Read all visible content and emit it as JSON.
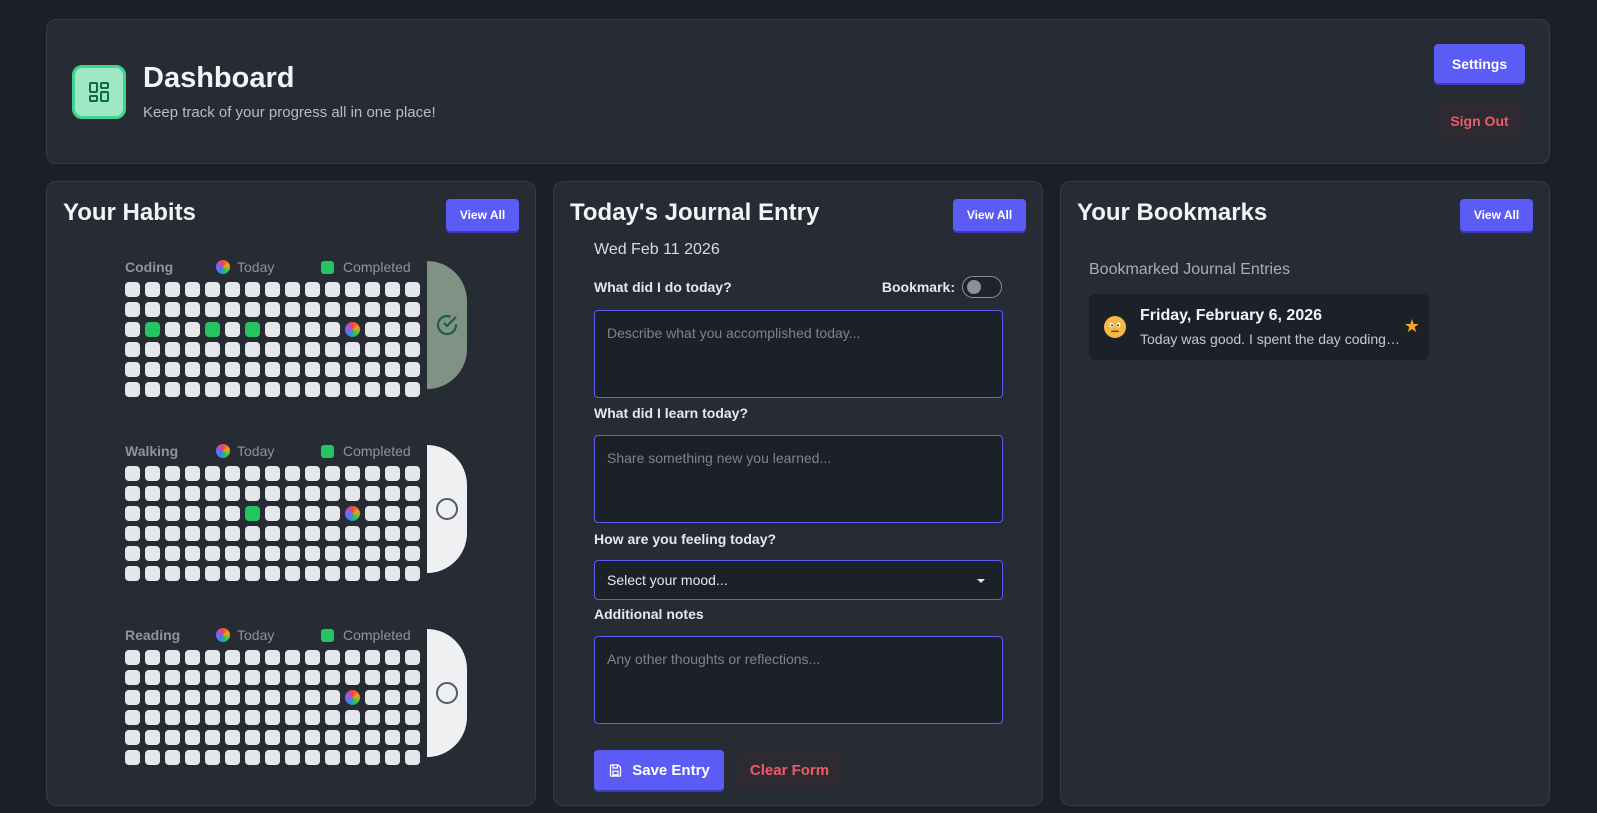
{
  "header": {
    "title": "Dashboard",
    "subtitle": "Keep track of your progress all in one place!",
    "settings_label": "Settings",
    "signout_label": "Sign Out",
    "logo_icon": "dashboard-grid-icon",
    "accent_color": "#5b5bf5",
    "logo_color": "#3fd38e"
  },
  "habits": {
    "title": "Your Habits",
    "view_all_label": "View All",
    "today_label": "Today",
    "completed_label": "Completed",
    "grid_rows": 6,
    "grid_cols": 15,
    "items": [
      {
        "name": "Coding",
        "checked": true,
        "completed_cells": [
          [
            2,
            1
          ],
          [
            2,
            4
          ],
          [
            2,
            6
          ]
        ],
        "today_cell": [
          2,
          11
        ]
      },
      {
        "name": "Walking",
        "checked": false,
        "completed_cells": [
          [
            2,
            6
          ]
        ],
        "today_cell": [
          2,
          11
        ]
      },
      {
        "name": "Reading",
        "checked": false,
        "completed_cells": [],
        "today_cell": [
          2,
          11
        ]
      }
    ]
  },
  "journal": {
    "title": "Today's Journal Entry",
    "view_all_label": "View All",
    "date": "Wed Feb 11 2026",
    "bookmark_label": "Bookmark:",
    "bookmark_on": false,
    "q1_label": "What did I do today?",
    "q1_placeholder": "Describe what you accomplished today...",
    "q2_label": "What did I learn today?",
    "q2_placeholder": "Share something new you learned...",
    "q3_label": "How are you feeling today?",
    "mood_value": "Select your mood...",
    "q4_label": "Additional notes",
    "q4_placeholder": "Any other thoughts or reflections...",
    "save_label": "Save Entry",
    "clear_label": "Clear Form"
  },
  "bookmarks": {
    "title": "Your Bookmarks",
    "view_all_label": "View All",
    "subtitle": "Bookmarked Journal Entries",
    "entries": [
      {
        "title": "Friday, February 6, 2026",
        "excerpt": "Today was good. I spent the day coding and learning new things.",
        "mood_icon": "neutral-face-icon"
      }
    ]
  }
}
